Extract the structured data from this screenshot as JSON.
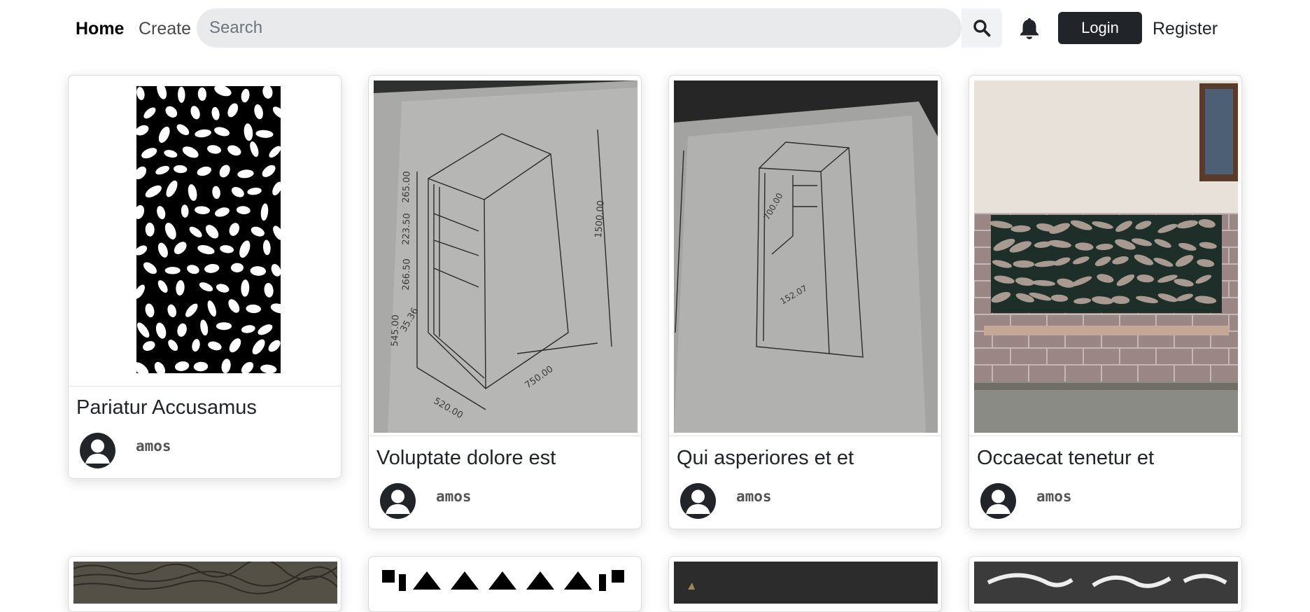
{
  "nav": {
    "home_label": "Home",
    "create_label": "Create",
    "search_placeholder": "Search",
    "login_label": "Login",
    "register_label": "Register"
  },
  "cards": [
    {
      "title": "Pariatur Accusamus",
      "author": "amos"
    },
    {
      "title": "Voluptate dolore est",
      "author": "amos"
    },
    {
      "title": "Qui asperiores et et",
      "author": "amos"
    },
    {
      "title": "Occaecat tenetur et",
      "author": "amos"
    }
  ],
  "drawing_labels": {
    "card2": [
      "265.00",
      "223.50",
      "266.50",
      "545.00",
      "35.36",
      "520.00",
      "750.00",
      "1500.00"
    ],
    "card3": [
      "700.00",
      "152.07"
    ]
  },
  "colors": {
    "text": "#212529",
    "login_bg": "#212529",
    "search_bg": "#e9eaec",
    "muted": "#6c757d"
  },
  "icons": [
    "search-icon",
    "bell-icon",
    "user-avatar-icon"
  ]
}
